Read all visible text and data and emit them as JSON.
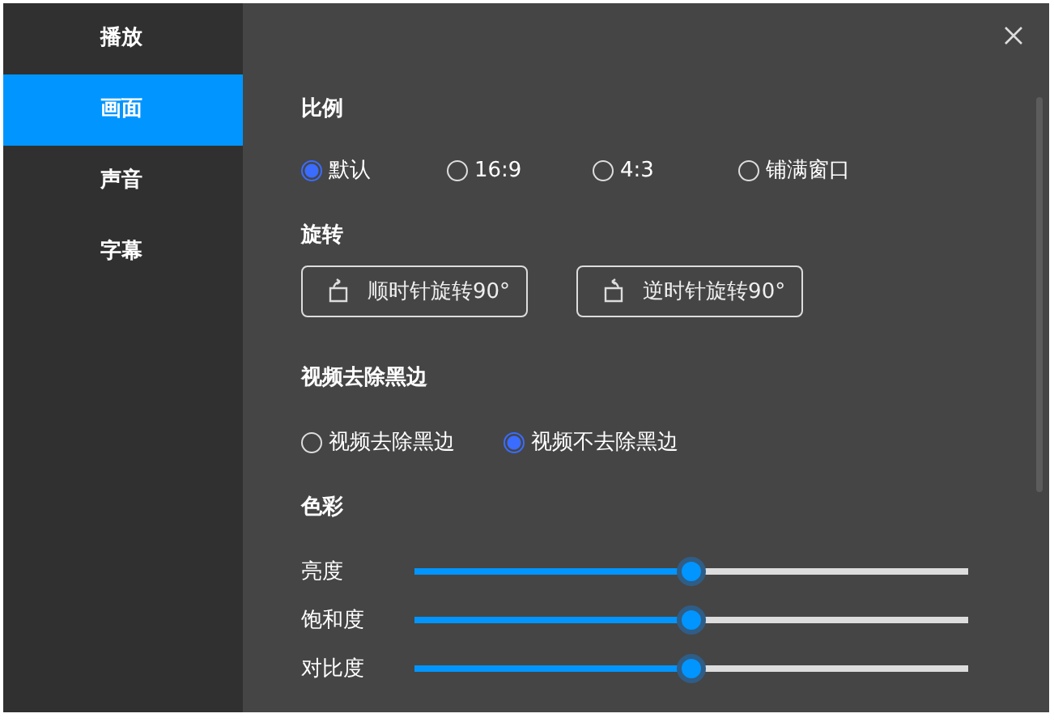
{
  "sidebar": {
    "items": [
      {
        "label": "播放",
        "selected": false
      },
      {
        "label": "画面",
        "selected": true
      },
      {
        "label": "声音",
        "selected": false
      },
      {
        "label": "字幕",
        "selected": false
      }
    ]
  },
  "sections": [
    {
      "title": "比例",
      "kind": "radios",
      "options": [
        {
          "label": "默认",
          "selected": true
        },
        {
          "label": "16:9",
          "selected": false
        },
        {
          "label": "4:3",
          "selected": false
        },
        {
          "label": "铺满窗口",
          "selected": false
        }
      ]
    },
    {
      "title": "旋转",
      "kind": "buttons",
      "buttons": [
        {
          "label": "顺时针旋转90°",
          "kind": "cw"
        },
        {
          "label": "逆时针旋转90°",
          "kind": "ccw"
        }
      ]
    },
    {
      "title": "视频去除黑边",
      "kind": "radios",
      "options": [
        {
          "label": "视频去除黑边",
          "selected": false
        },
        {
          "label": "视频不去除黑边",
          "selected": true
        }
      ]
    },
    {
      "title": "色彩",
      "kind": "sliders",
      "sliders": [
        {
          "label": "亮度",
          "level": 0.5
        },
        {
          "label": "饱和度",
          "level": 0.5
        },
        {
          "label": "对比度",
          "level": 0.5
        }
      ]
    }
  ]
}
